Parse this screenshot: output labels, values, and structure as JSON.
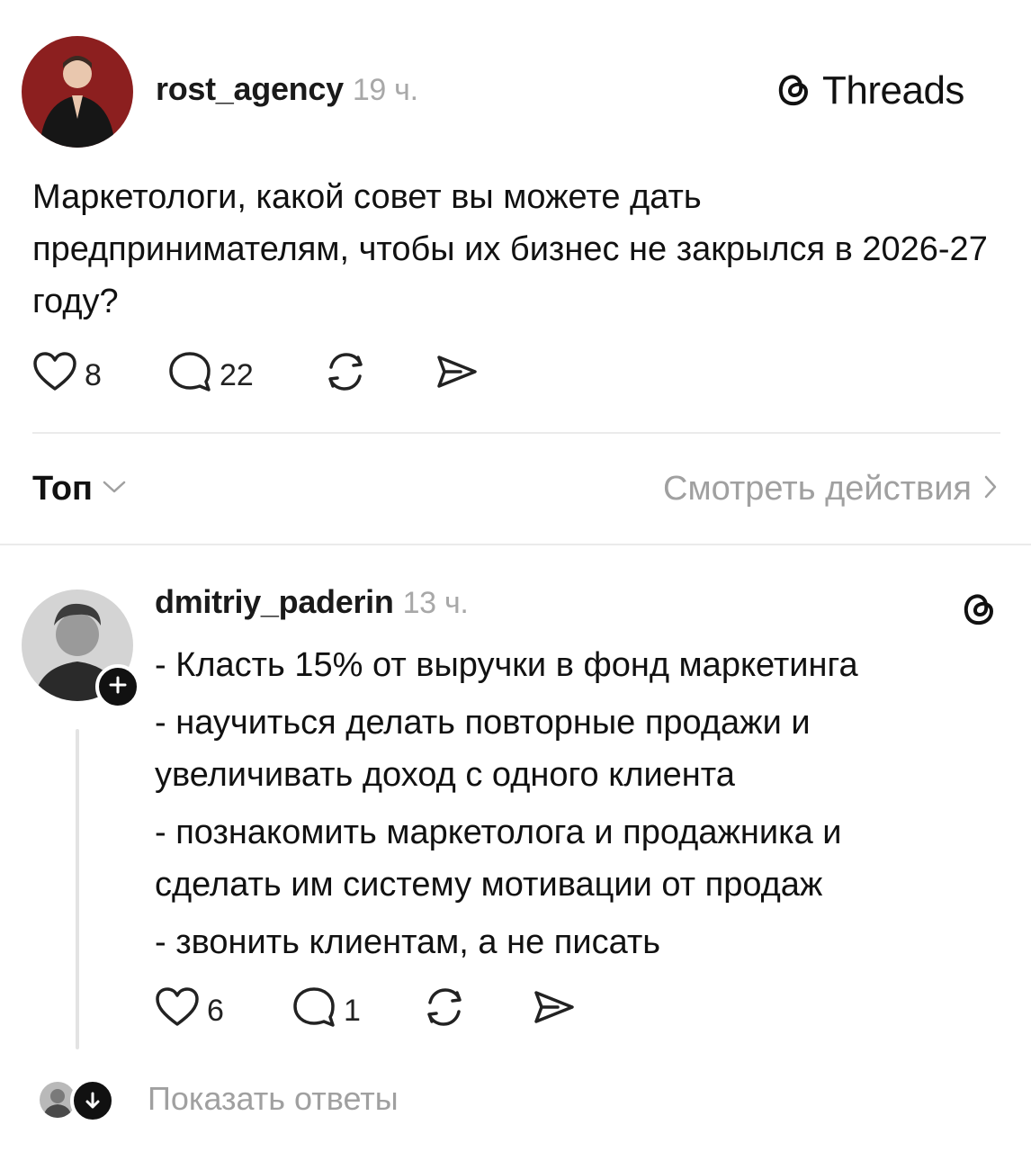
{
  "post": {
    "username": "rost_agency",
    "time": "19 ч.",
    "brand": "Threads",
    "text": "Маркетологи, какой совет вы можете дать предпринимателям, чтобы их бизнес не закрылся в 2026-27 году?",
    "likes": "8",
    "comments": "22",
    "icons": [
      "heart-icon",
      "comment-icon",
      "repost-icon",
      "share-icon"
    ]
  },
  "sort": {
    "label": "Топ",
    "activity_label": "Смотреть действия"
  },
  "reply": {
    "username": "dmitriy_paderin",
    "time": "13 ч.",
    "lines": [
      "- Класть 15% от выручки в фонд маркетинга",
      "- научиться делать повторные продажи и",
      "увеличивать доход с одного клиента",
      "- познакомить маркетолога и продажника и",
      "сделать им систему мотивации от продаж",
      "- звонить клиентам, а не писать"
    ],
    "likes": "6",
    "comments": "1"
  },
  "show_replies": {
    "label": "Показать ответы"
  },
  "colors": {
    "text": "#111111",
    "muted": "#a0a0a0",
    "divider": "#ebebeb"
  }
}
